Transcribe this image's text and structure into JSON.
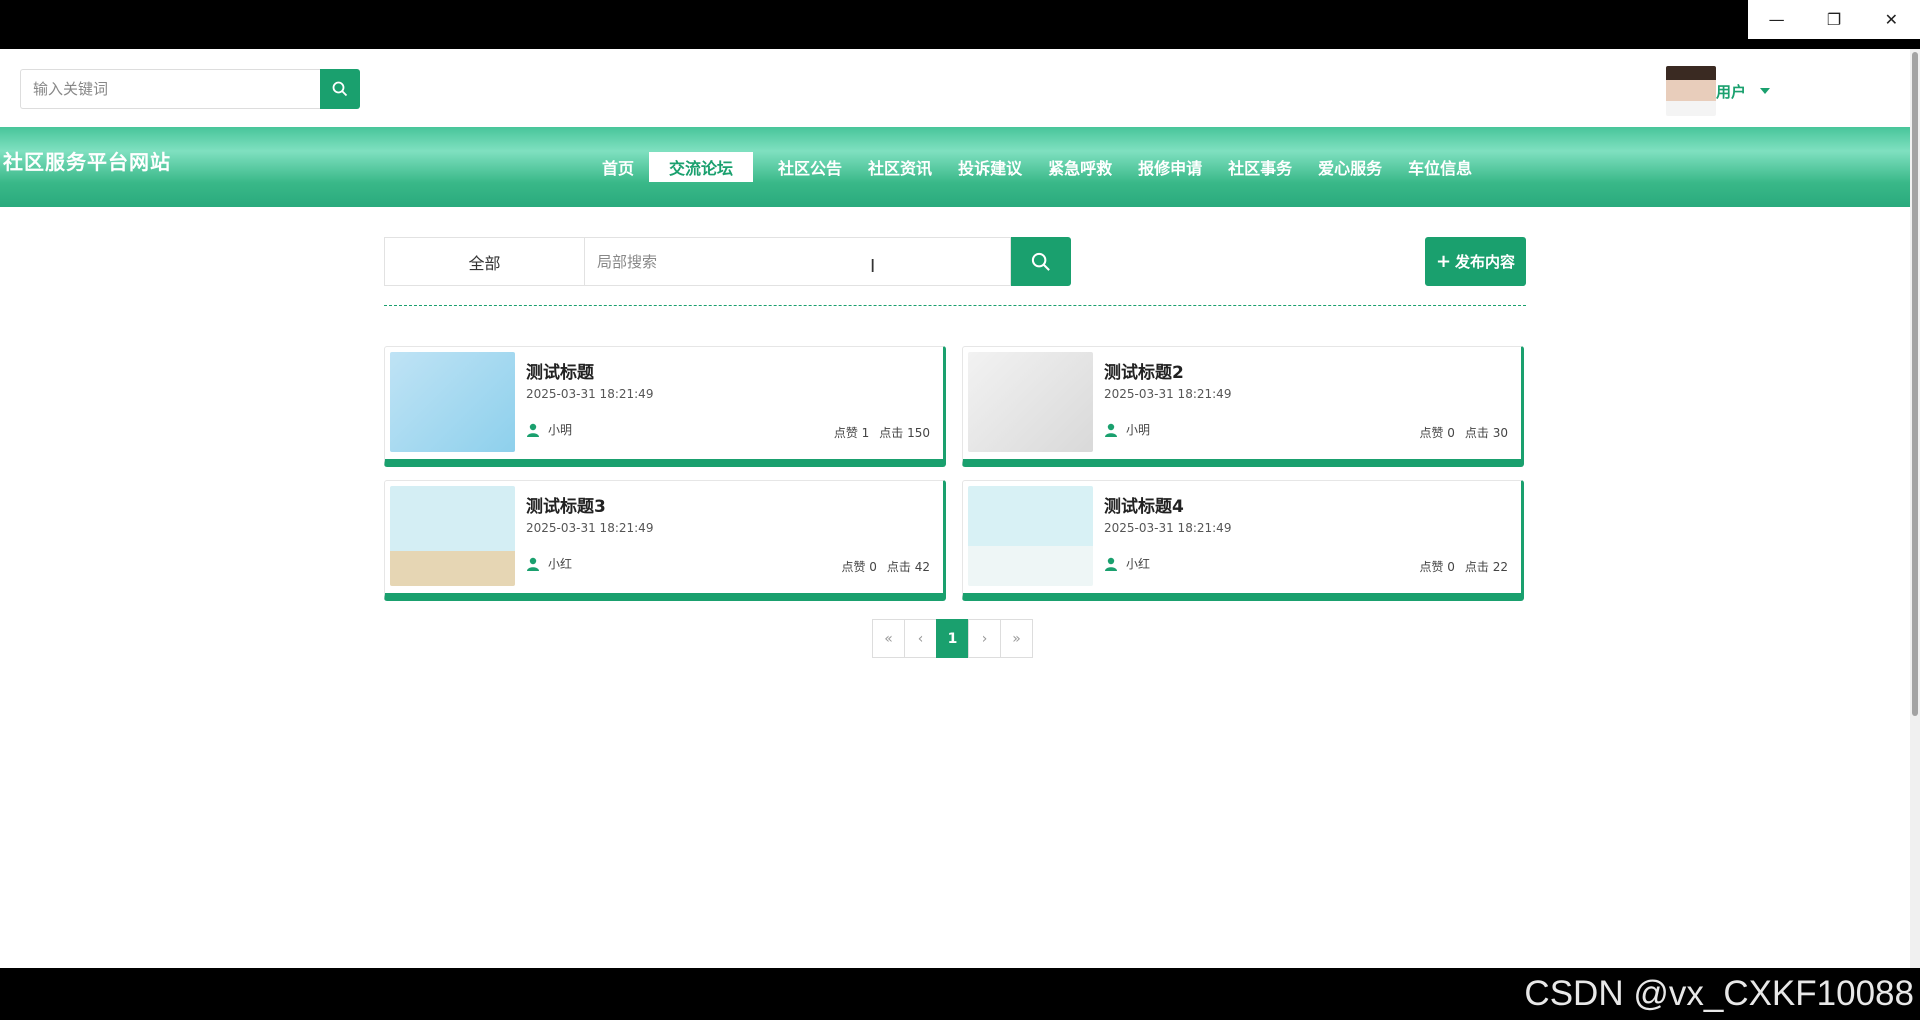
{
  "window": {
    "minimize": "—",
    "restore": "❐",
    "close": "✕"
  },
  "topbar": {
    "search_placeholder": "输入关键词",
    "user_name": "用户"
  },
  "nav": {
    "site_title": "社区服务平台网站",
    "items": [
      "首页",
      "交流论坛",
      "社区公告",
      "社区资讯",
      "投诉建议",
      "紧急呼救",
      "报修申请",
      "社区事务",
      "爱心服务",
      "车位信息"
    ],
    "active_index": 1
  },
  "filter": {
    "category": "全部",
    "search_placeholder": "局部搜索",
    "publish_label": "发布内容"
  },
  "posts": [
    {
      "title": "测试标题",
      "date": "2025-03-31 18:21:49",
      "author": "小明",
      "likes": "点赞 1",
      "clicks": "点击 150"
    },
    {
      "title": "测试标题2",
      "date": "2025-03-31 18:21:49",
      "author": "小明",
      "likes": "点赞 0",
      "clicks": "点击 30"
    },
    {
      "title": "测试标题3",
      "date": "2025-03-31 18:21:49",
      "author": "小红",
      "likes": "点赞 0",
      "clicks": "点击 42"
    },
    {
      "title": "测试标题4",
      "date": "2025-03-31 18:21:49",
      "author": "小红",
      "likes": "点赞 0",
      "clicks": "点击 22"
    }
  ],
  "pager": {
    "first": "«",
    "prev": "‹",
    "current": "1",
    "next": "›",
    "last": "»"
  },
  "watermark": "CSDN @vx_CXKF10088",
  "colors": {
    "accent": "#1aa06e"
  }
}
